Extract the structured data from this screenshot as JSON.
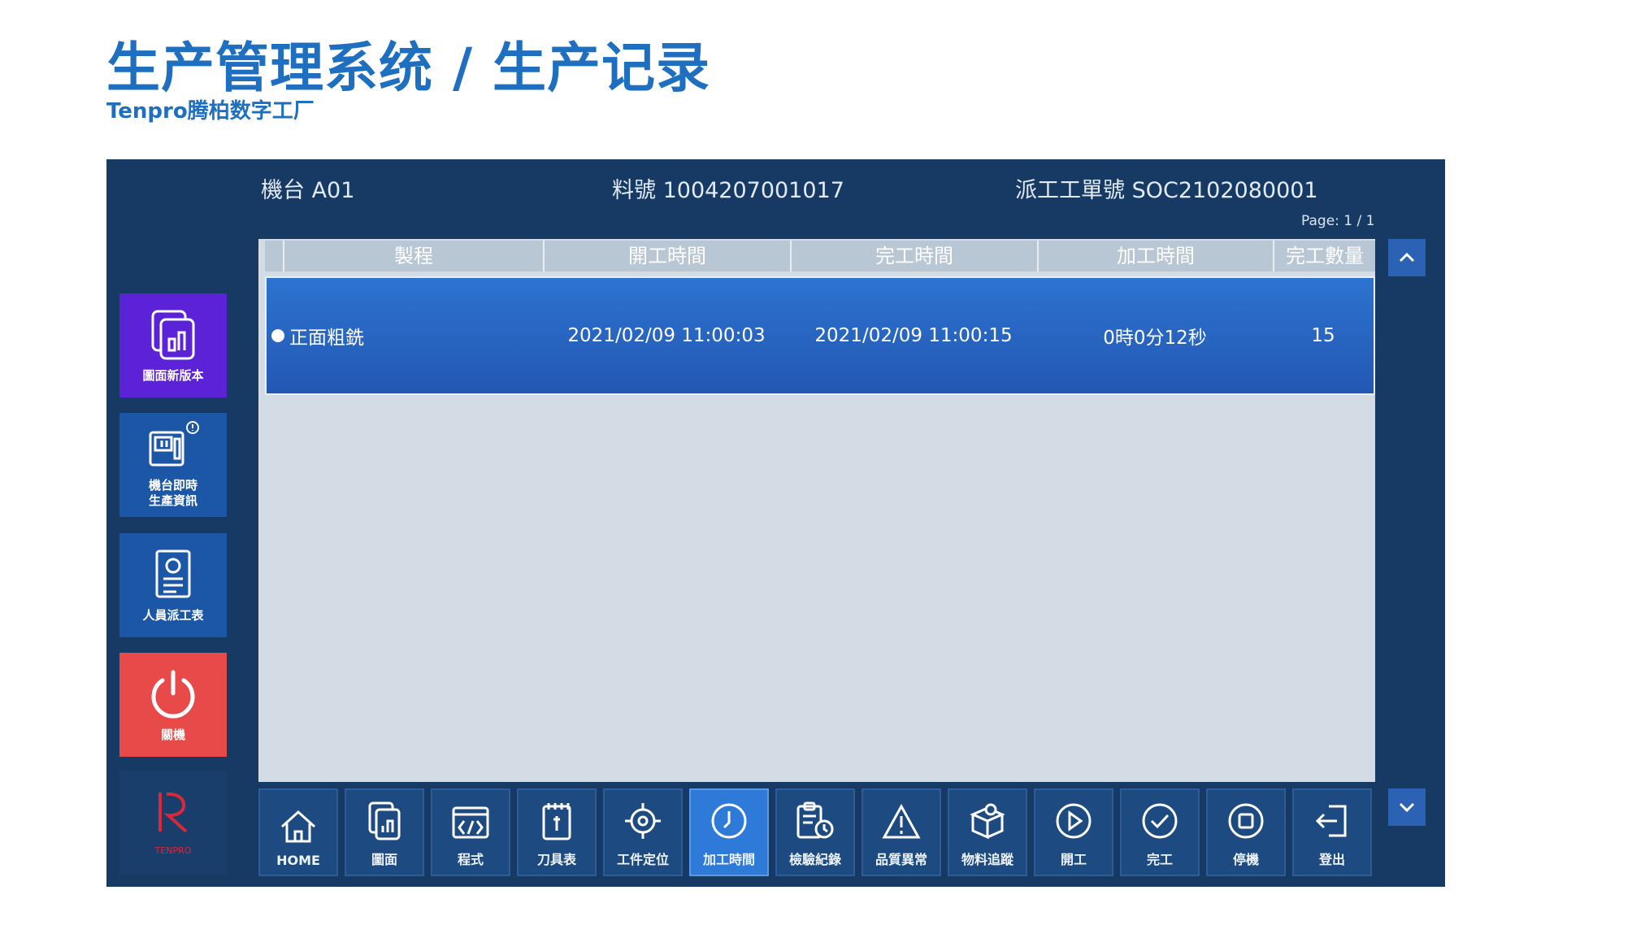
{
  "slide": {
    "title": "生产管理系统 / 生产记录",
    "subtitle": "Tenpro腾柏数字工厂"
  },
  "header": {
    "machine": "機台 A01",
    "part_no": "料號 1004207001017",
    "work_order": "派工工單號 SOC2102080001",
    "page": "Page: 1 / 1"
  },
  "sidebar": {
    "items": [
      {
        "label": "圖面新版本",
        "icon": "drawing-file-icon"
      },
      {
        "label": "機台即時",
        "label2": "生產資訊",
        "icon": "machine-info-icon"
      },
      {
        "label": "人員派工表",
        "icon": "dispatch-list-icon"
      },
      {
        "label": "關機",
        "icon": "power-icon"
      },
      {
        "label": "TENPRO",
        "icon": "tenpro-logo"
      }
    ]
  },
  "table": {
    "columns": [
      "製程",
      "開工時間",
      "完工時間",
      "加工時間",
      "完工數量"
    ],
    "rows": [
      {
        "process": "正面粗銑",
        "start": "2021/02/09 11:00:03",
        "end": "2021/02/09 11:00:15",
        "duration": "0時0分12秒",
        "qty": "15",
        "selected": true
      }
    ]
  },
  "toolbar": {
    "items": [
      {
        "label": "HOME",
        "icon": "home-icon"
      },
      {
        "label": "圖面",
        "icon": "drawing-icon"
      },
      {
        "label": "程式",
        "icon": "code-icon"
      },
      {
        "label": "刀具表",
        "icon": "tool-list-icon"
      },
      {
        "label": "工件定位",
        "icon": "locate-icon"
      },
      {
        "label": "加工時間",
        "icon": "clock-icon",
        "active": true
      },
      {
        "label": "檢驗紀錄",
        "icon": "inspection-icon"
      },
      {
        "label": "品質異常",
        "icon": "warning-icon"
      },
      {
        "label": "物料追蹤",
        "icon": "material-icon"
      },
      {
        "label": "開工",
        "icon": "play-icon"
      },
      {
        "label": "完工",
        "icon": "check-icon"
      },
      {
        "label": "停機",
        "icon": "stop-icon"
      },
      {
        "label": "登出",
        "icon": "logout-icon"
      }
    ]
  },
  "colors": {
    "accent": "#1f6fc0",
    "app_background": "#173a64",
    "selected_row": "#2a66c4",
    "power_button": "#e84a4a",
    "drawing_button": "#5b22d8"
  }
}
